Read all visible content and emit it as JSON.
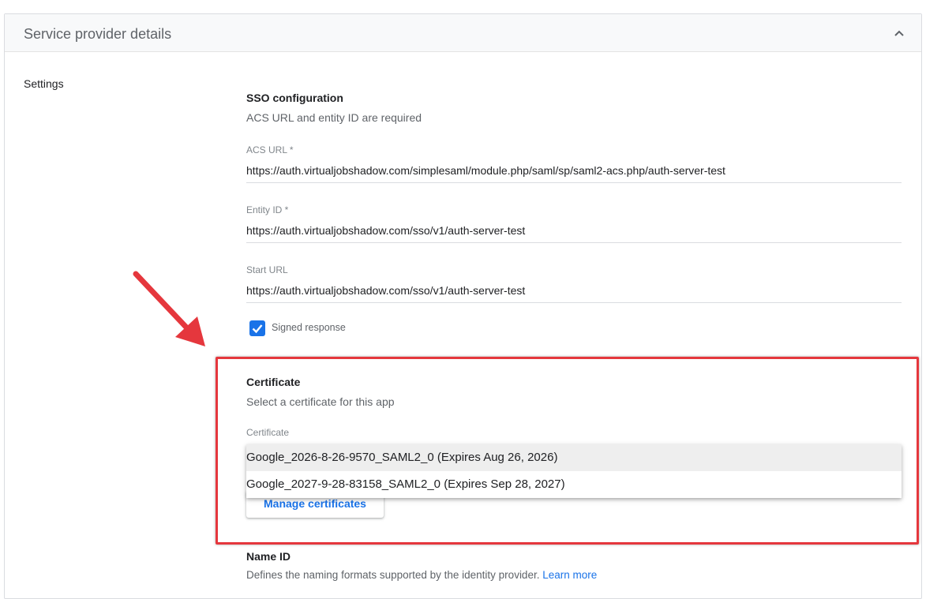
{
  "panel": {
    "title": "Service provider details",
    "collapse_icon": "chevron-up-icon"
  },
  "settings": {
    "label": "Settings"
  },
  "sso": {
    "title": "SSO configuration",
    "description": "ACS URL and entity ID are required",
    "acs_url_label": "ACS URL *",
    "acs_url_value": "https://auth.virtualjobshadow.com/simplesaml/module.php/saml/sp/saml2-acs.php/auth-server-test",
    "entity_id_label": "Entity ID *",
    "entity_id_value": "https://auth.virtualjobshadow.com/sso/v1/auth-server-test",
    "start_url_label": "Start URL",
    "start_url_value": "https://auth.virtualjobshadow.com/sso/v1/auth-server-test",
    "signed_response_label": "Signed response",
    "signed_response_checked": true
  },
  "certificate": {
    "title": "Certificate",
    "description": "Select a certificate for this app",
    "field_label": "Certificate",
    "options": [
      "Google_2026-8-26-9570_SAML2_0 (Expires Aug 26, 2026)",
      "Google_2027-9-28-83158_SAML2_0 (Expires Sep 28, 2027)"
    ],
    "manage_label": "Manage certificates"
  },
  "name_id": {
    "title": "Name ID",
    "description": "Defines the naming formats supported by the identity provider.",
    "learn_more": "Learn more"
  },
  "colors": {
    "accent": "#1a73e8",
    "annotation": "#e5373d"
  }
}
